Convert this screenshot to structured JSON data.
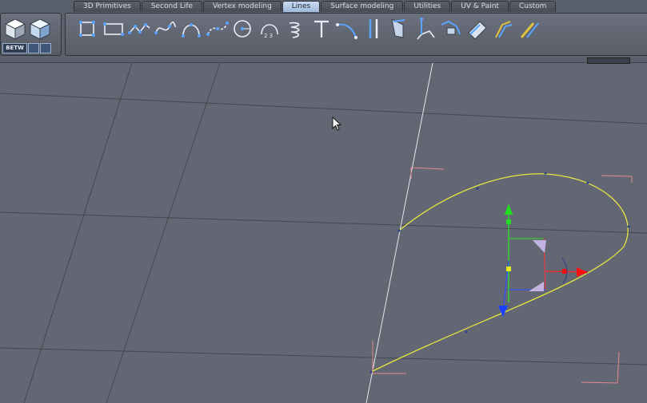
{
  "tabs": [
    {
      "label": "3D Primitives",
      "active": false
    },
    {
      "label": "Second Life",
      "active": false
    },
    {
      "label": "Vertex modeling",
      "active": false
    },
    {
      "label": "Lines",
      "active": true
    },
    {
      "label": "Surface modeling",
      "active": false
    },
    {
      "label": "Utilities",
      "active": false
    },
    {
      "label": "UV & Paint",
      "active": false
    },
    {
      "label": "Custom",
      "active": false
    }
  ],
  "left_panel": {
    "view_buttons": [
      "cube-solid-icon",
      "cube-shaded-icon"
    ],
    "mode_label": "BETW"
  },
  "tools": [
    "line-square-icon",
    "line-rectangle-icon",
    "polyline-icon",
    "curve-icon",
    "arc-icon",
    "bezier-icon",
    "circle-icon",
    "numbered-arc-icon",
    "spiral-icon",
    "text-tool-icon",
    "line-bend-icon",
    "line-split-icon",
    "line-extrude-icon",
    "line-rotate-icon",
    "line-sweep-icon",
    "line-mirror-icon",
    "line-loft-icon",
    "line-weld-icon"
  ],
  "colors": {
    "viewport_bg": "#626773",
    "grid_line": "#3d424b",
    "axis_white": "#e6e8ec",
    "curve": "#e0e040",
    "gizmo_x": "#ff2020",
    "gizmo_y": "#20e020",
    "gizmo_z": "#2040ff"
  }
}
